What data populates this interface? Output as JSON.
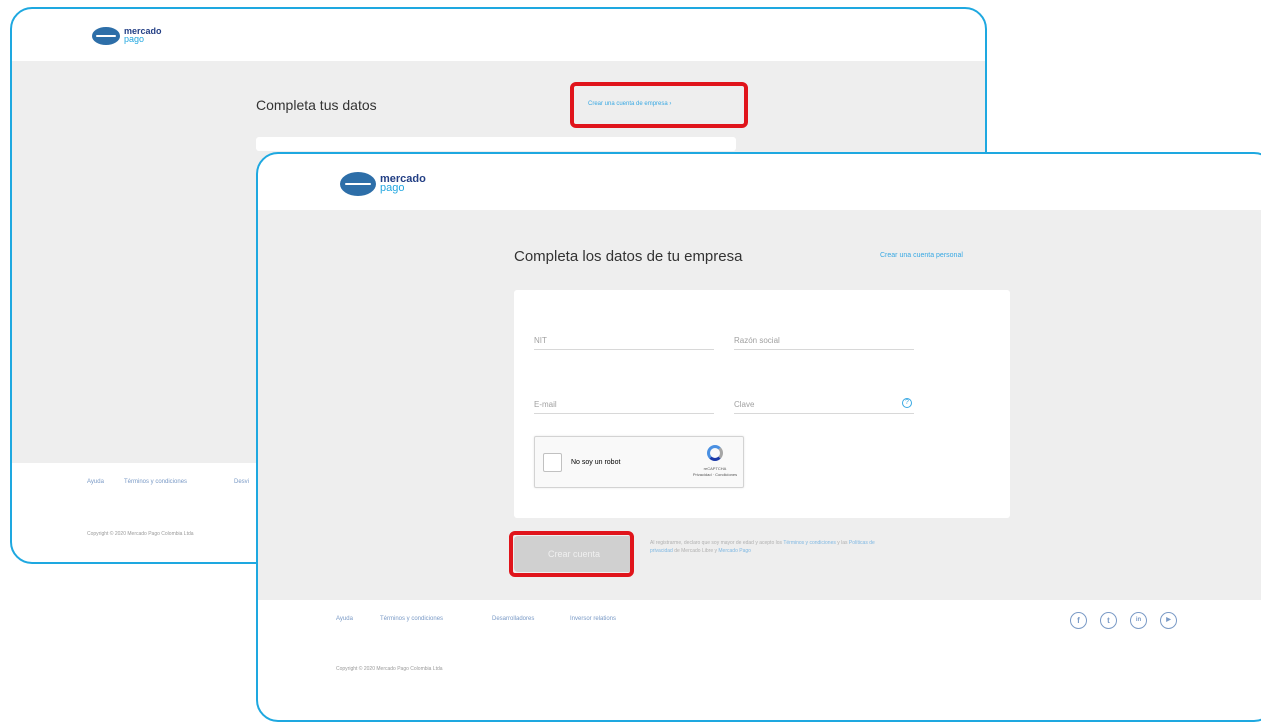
{
  "back": {
    "logo": {
      "word": "mercado",
      "sub": "pago"
    },
    "page_title": "Completa tus datos",
    "switch_link": "Crear una cuenta de empresa ›",
    "footer_links": [
      "Ayuda",
      "Términos y condiciones",
      "Desvi"
    ],
    "copyright": "Copyright © 2020 Mercado Pago Colombia Ltda"
  },
  "front": {
    "logo": {
      "word": "mercado",
      "sub": "pago"
    },
    "page_title": "Completa los datos de tu empresa",
    "switch_link": "Crear una cuenta personal",
    "form": {
      "nit_placeholder": "NIT",
      "razon_placeholder": "Razón social",
      "email_placeholder": "E-mail",
      "clave_placeholder": "Clave",
      "help_glyph": "?"
    },
    "captcha": {
      "label": "No soy un robot",
      "brand": "reCAPTCHA",
      "terms": "Privacidad · Condiciones"
    },
    "submit_label": "Crear cuenta",
    "legal": {
      "pre": "Al registrarme, declaro que soy mayor de edad y acepto los",
      "link1": "Términos y condiciones",
      "mid": "y las",
      "link2": "Políticas de privacidad",
      "mid2": "de Mercado Libre y",
      "link3": "Mercado Pago"
    },
    "footer_links": [
      "Ayuda",
      "Términos y condiciones",
      "Desarrolladores",
      "Inversor relations"
    ],
    "social_icons": [
      {
        "name": "facebook-icon",
        "glyph": "f"
      },
      {
        "name": "twitter-icon",
        "glyph": "t"
      },
      {
        "name": "linkedin-icon",
        "glyph": "in"
      },
      {
        "name": "youtube-icon",
        "glyph": "▶"
      }
    ],
    "copyright": "Copyright © 2020 Mercado Pago Colombia Ltda"
  },
  "colors": {
    "frame_border": "#1ea8e0",
    "highlight": "#e0141b",
    "link": "#38a8e3",
    "band": "#eeeeee"
  }
}
